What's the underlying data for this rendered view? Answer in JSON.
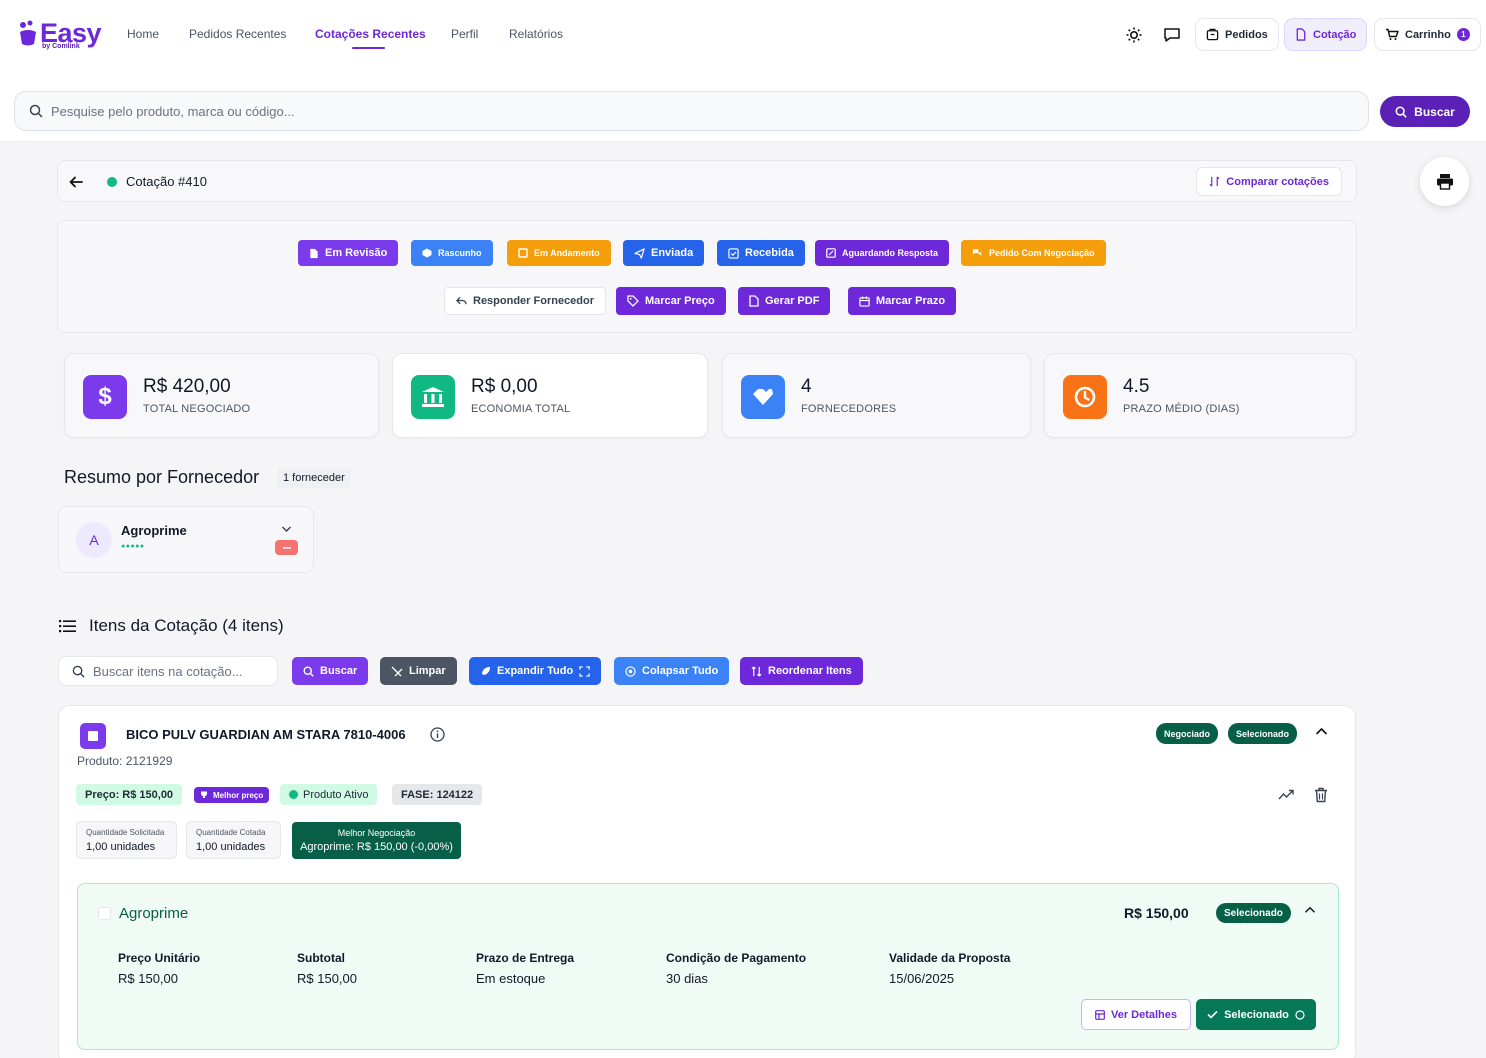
{
  "brand": {
    "name": "Easy",
    "sub": "by Comlink",
    "color": "#6d28d9"
  },
  "nav": {
    "home": "Home",
    "pedidos_recentes": "Pedidos Recentes",
    "cotacoes_recentes": "Cotações Recentes",
    "perfil": "Perfil",
    "relatorios": "Relatórios"
  },
  "header_buttons": {
    "pedidos": "Pedidos",
    "cotacao": "Cotação",
    "carrinho": "Carrinho",
    "cart_count": "1"
  },
  "search": {
    "placeholder": "Pesquise pelo produto, marca ou código...",
    "button": "Buscar"
  },
  "quote": {
    "title": "Cotação #410",
    "compare": "Comparar cotações",
    "status_color": "#10b981"
  },
  "status_buttons": {
    "em_revisao": "Em Revisão",
    "rascunho": "Rascunho",
    "em_andamento": "Em Andamento",
    "enviada": "Enviada",
    "recebida": "Recebida",
    "aguardando": "Aguardando Resposta",
    "pedido_negociacao": "Pedido Com Negociação"
  },
  "action_buttons": {
    "responder": "Responder Fornecedor",
    "marcar_preco": "Marcar Preço",
    "gerar_pdf": "Gerar PDF",
    "marcar_prazo": "Marcar Prazo"
  },
  "stats": {
    "total": {
      "value": "R$ 420,00",
      "label": "TOTAL NEGOCIADO"
    },
    "economia": {
      "value": "R$ 0,00",
      "label": "ECONOMIA TOTAL"
    },
    "fornecedores": {
      "value": "4",
      "label": "FORNECEDORES"
    },
    "prazo": {
      "value": "4.5",
      "label": "PRAZO MÉDIO (DIAS)"
    }
  },
  "resumo": {
    "title": "Resumo por Fornecedor",
    "count": "1 forneceder"
  },
  "supplier": {
    "initial": "A",
    "name": "Agroprime",
    "rating": "●●●●●"
  },
  "itens": {
    "title": "Itens da Cotação (4 itens)",
    "search_placeholder": "Buscar itens na cotação...",
    "buscar": "Buscar",
    "limpar": "Limpar",
    "expandir": "Expandir Tudo",
    "colapsar": "Colapsar Tudo",
    "reordenar": "Reordenar Itens"
  },
  "item": {
    "title": "BICO PULV GUARDIAN AM STARA 7810-4006",
    "code": "Produto: 2121929",
    "badge_negociado": "Negociado",
    "badge_selecionado": "Selecionado",
    "preco": "Preço: R$ 150,00",
    "melhor_preco": "Melhor preço",
    "produto_ativo": "Produto Ativo",
    "fase": "FASE: 124122",
    "qtd_solicitada_label": "Quantidade Solicitada",
    "qtd_solicitada": "1,00 unidades",
    "qtd_cotada_label": "Quantidade Cotada",
    "qtd_cotada": "1,00 unidades",
    "melhor_neg_label": "Melhor Negociação",
    "melhor_neg": "Agroprime: R$ 150,00 (-0,00%)"
  },
  "offer": {
    "supplier": "Agroprime",
    "price": "R$ 150,00",
    "status": "Selecionado",
    "fields": {
      "preco_unit_label": "Preço Unitário",
      "preco_unit": "R$ 150,00",
      "subtotal_label": "Subtotal",
      "subtotal": "R$ 150,00",
      "prazo_label": "Prazo de Entrega",
      "prazo": "Em estoque",
      "condicao_label": "Condição de Pagamento",
      "condicao": "30 dias",
      "validade_label": "Validade da Proposta",
      "validade": "15/06/2025"
    },
    "ver_detalhes": "Ver Detalhes",
    "selecionado_btn": "Selecionado"
  }
}
